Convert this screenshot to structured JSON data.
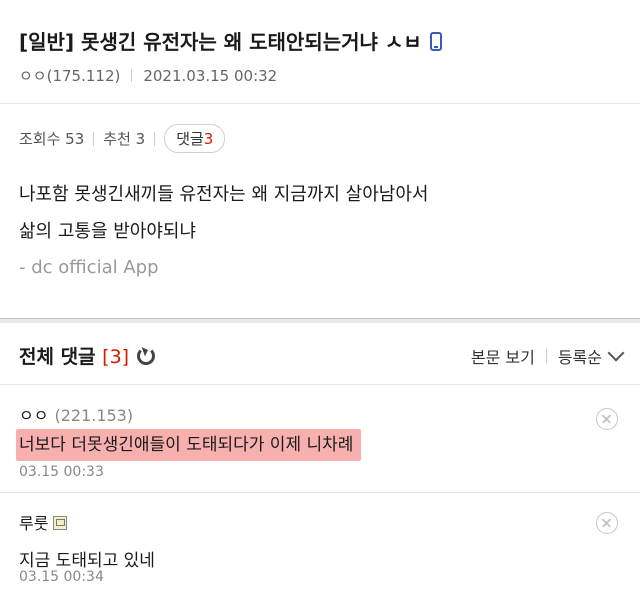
{
  "post": {
    "title": "[일반] 못생긴 유전자는 왜 도태안되는거냐 ㅅㅂ",
    "device_icon": "mobile-phone-icon",
    "author": "ㅇㅇ(175.112)",
    "date": "2021.03.15 00:32",
    "views_label": "조회수 53",
    "recommend_label": "추천 3",
    "reply_label": "댓글",
    "reply_count": "3",
    "body_line1": "나포함 못생긴새끼들 유전자는 왜 지금까지 살아남아서",
    "body_line2": "삶의 고통을 받아야되냐",
    "signature": "- dc official App"
  },
  "comments_header": {
    "title": "전체 댓글",
    "count": "[3]",
    "view_post": "본문 보기",
    "sort": "등록순"
  },
  "comments": [
    {
      "author": "ㅇㅇ",
      "ip": "(221.153)",
      "text": "너보다 더못생긴애들이 도태되다가 이제 니차례",
      "date": "03.15 00:33",
      "highlight_color": "#f7b0ae"
    },
    {
      "author": "루룻",
      "text": "지금 도태되고 있네",
      "date": "03.15 00:34"
    }
  ],
  "colors": {
    "accent_red": "#d31900",
    "device_blue": "#3a5ab7"
  }
}
